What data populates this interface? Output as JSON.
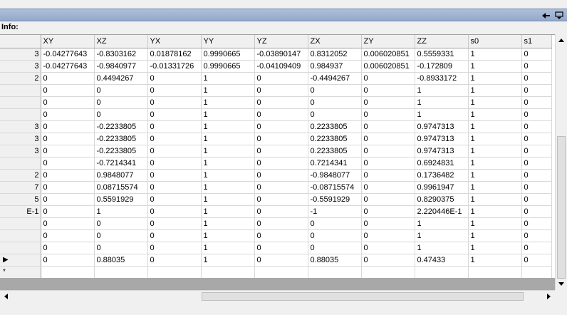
{
  "panel": {
    "info_label": "Info:",
    "pin_icon": "pin-icon",
    "menu_icon": "dropdown-menu-icon"
  },
  "grid": {
    "columns": [
      "XY",
      "XZ",
      "YX",
      "YY",
      "YZ",
      "ZX",
      "ZY",
      "ZZ",
      "s0",
      "s1"
    ],
    "row_header_fragments": [
      "3",
      "3",
      "2",
      "",
      "",
      "",
      "3",
      "3",
      "3",
      "",
      "2",
      "7",
      "5",
      "E-1",
      "",
      "",
      "",
      "",
      ""
    ],
    "current_row_marker": "▶",
    "new_row_marker": "*",
    "rows": [
      [
        "-0.04277643",
        "-0.8303162",
        "0.01878162",
        "0.9990665",
        "-0.03890147",
        "0.8312052",
        "0.006020851",
        "0.5559331",
        "1",
        "0"
      ],
      [
        "-0.04277643",
        "-0.9840977",
        "-0.01331726",
        "0.9990665",
        "-0.04109409",
        "0.984937",
        "0.006020851",
        "-0.172809",
        "1",
        "0"
      ],
      [
        "0",
        "0.4494267",
        "0",
        "1",
        "0",
        "-0.4494267",
        "0",
        "-0.8933172",
        "1",
        "0"
      ],
      [
        "0",
        "0",
        "0",
        "1",
        "0",
        "0",
        "0",
        "1",
        "1",
        "0"
      ],
      [
        "0",
        "0",
        "0",
        "1",
        "0",
        "0",
        "0",
        "1",
        "1",
        "0"
      ],
      [
        "0",
        "0",
        "0",
        "1",
        "0",
        "0",
        "0",
        "1",
        "1",
        "0"
      ],
      [
        "0",
        "-0.2233805",
        "0",
        "1",
        "0",
        "0.2233805",
        "0",
        "0.9747313",
        "1",
        "0"
      ],
      [
        "0",
        "-0.2233805",
        "0",
        "1",
        "0",
        "0.2233805",
        "0",
        "0.9747313",
        "1",
        "0"
      ],
      [
        "0",
        "-0.2233805",
        "0",
        "1",
        "0",
        "0.2233805",
        "0",
        "0.9747313",
        "1",
        "0"
      ],
      [
        "0",
        "-0.7214341",
        "0",
        "1",
        "0",
        "0.7214341",
        "0",
        "0.6924831",
        "1",
        "0"
      ],
      [
        "0",
        "0.9848077",
        "0",
        "1",
        "0",
        "-0.9848077",
        "0",
        "0.1736482",
        "1",
        "0"
      ],
      [
        "0",
        "0.08715574",
        "0",
        "1",
        "0",
        "-0.08715574",
        "0",
        "0.9961947",
        "1",
        "0"
      ],
      [
        "0",
        "0.5591929",
        "0",
        "1",
        "0",
        "-0.5591929",
        "0",
        "0.8290375",
        "1",
        "0"
      ],
      [
        "0",
        "1",
        "0",
        "1",
        "0",
        "-1",
        "0",
        "2.220446E-1",
        "1",
        "0"
      ],
      [
        "0",
        "0",
        "0",
        "1",
        "0",
        "0",
        "0",
        "1",
        "1",
        "0"
      ],
      [
        "0",
        "0",
        "0",
        "1",
        "0",
        "0",
        "0",
        "1",
        "1",
        "0"
      ],
      [
        "0",
        "0",
        "0",
        "1",
        "0",
        "0",
        "0",
        "1",
        "1",
        "0"
      ],
      [
        "0",
        "0.88035",
        "0",
        "1",
        "0",
        "0.88035",
        "0",
        "0.47433",
        "1",
        "0"
      ]
    ]
  }
}
